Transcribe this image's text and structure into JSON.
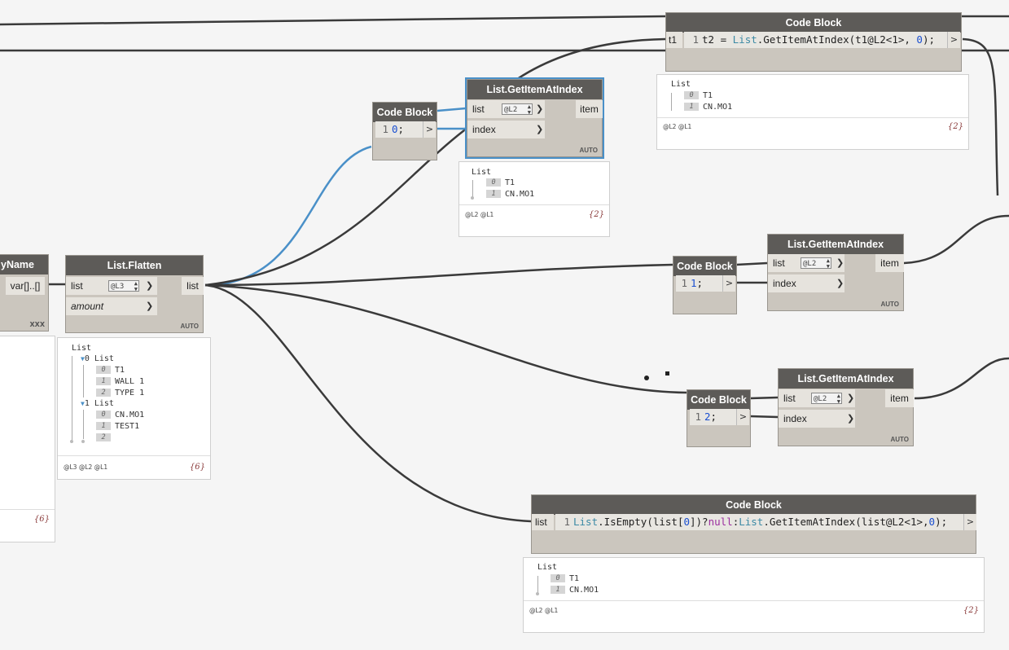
{
  "colors": {
    "wire": "#3a3a3a",
    "wire_selected": "#4a90c8",
    "header": "#5d5b58",
    "body": "#cbc6be"
  },
  "nodes": {
    "byname": {
      "title": "yName",
      "output": "var[]..[]",
      "footer": "XXX",
      "preview_count": "{6}"
    },
    "flatten": {
      "title": "List.Flatten",
      "in_list": "list",
      "in_amount": "amount",
      "lacing": "@L3",
      "output": "list",
      "auto": "AUTO",
      "preview": {
        "root": "List",
        "g0": "0 List",
        "g0_items": [
          {
            "i": "0",
            "v": "T1"
          },
          {
            "i": "1",
            "v": "WALL 1"
          },
          {
            "i": "2",
            "v": "TYPE 1"
          }
        ],
        "g1": "1 List",
        "g1_items": [
          {
            "i": "0",
            "v": "CN.MO1"
          },
          {
            "i": "1",
            "v": "TEST1"
          },
          {
            "i": "2",
            "v": ""
          }
        ],
        "levels": "@L3 @L2 @L1",
        "count": "{6}"
      }
    },
    "cb_zero": {
      "title": "Code Block",
      "line": "1",
      "code_num": "0",
      "code_end": ";",
      "out": ">"
    },
    "getitem_top": {
      "title": "List.GetItemAtIndex",
      "in_list": "list",
      "in_index": "index",
      "lacing": "@L2",
      "output": "item",
      "auto": "AUTO",
      "preview": {
        "root": "List",
        "items": [
          {
            "i": "0",
            "v": "T1"
          },
          {
            "i": "1",
            "v": "CN.MO1"
          }
        ],
        "levels": "@L2 @L1",
        "count": "{2}"
      }
    },
    "cb_main": {
      "title": "Code Block",
      "input": "t1",
      "line": "1",
      "code_a": "t2 = ",
      "code_kw": "List",
      "code_b": ".GetItemAtIndex(t1@L2<1>, ",
      "code_num": "0",
      "code_c": ");",
      "out": ">",
      "preview": {
        "root": "List",
        "items": [
          {
            "i": "0",
            "v": "T1"
          },
          {
            "i": "1",
            "v": "CN.MO1"
          }
        ],
        "levels": "@L2 @L1",
        "count": "{2}"
      }
    },
    "cb_one": {
      "title": "Code Block",
      "line": "1",
      "code_num": "1",
      "code_end": ";",
      "out": ">"
    },
    "getitem_mid": {
      "title": "List.GetItemAtIndex",
      "in_list": "list",
      "in_index": "index",
      "lacing": "@L2",
      "output": "item",
      "auto": "AUTO"
    },
    "cb_two": {
      "title": "Code Block",
      "line": "1",
      "code_num": "2",
      "code_end": ";",
      "out": ">"
    },
    "getitem_low": {
      "title": "List.GetItemAtIndex",
      "in_list": "list",
      "in_index": "index",
      "lacing": "@L2",
      "output": "item",
      "auto": "AUTO"
    },
    "cb_isempty": {
      "title": "Code Block",
      "input": "list",
      "line": "1",
      "code_kw1": "List",
      "code_a": ".IsEmpty(list[",
      "code_num1": "0",
      "code_b": "])?",
      "code_null": "null",
      "code_c": ":",
      "code_kw2": "List",
      "code_d": ".GetItemAtIndex(list@L2<1>,",
      "code_num2": "0",
      "code_e": ");",
      "out": ">",
      "preview": {
        "root": "List",
        "items": [
          {
            "i": "0",
            "v": "T1"
          },
          {
            "i": "1",
            "v": "CN.MO1"
          }
        ],
        "levels": "@L2 @L1",
        "count": "{2}"
      }
    }
  }
}
